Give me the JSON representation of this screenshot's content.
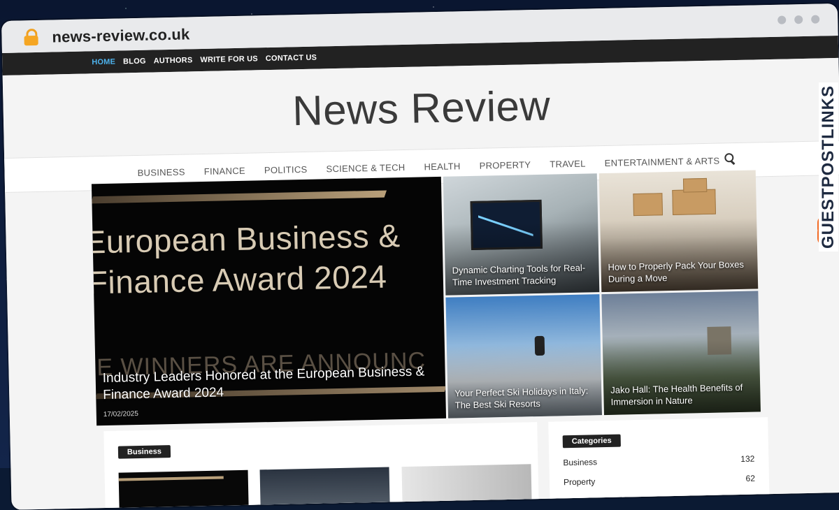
{
  "browser": {
    "url": "news-review.co.uk"
  },
  "top_nav": [
    "HOME",
    "BLOG",
    "AUTHORS",
    "WRITE FOR US",
    "CONTACT US"
  ],
  "site": {
    "title": "News Review"
  },
  "category_nav": [
    "BUSINESS",
    "FINANCE",
    "POLITICS",
    "SCIENCE & TECH",
    "HEALTH",
    "PROPERTY",
    "TRAVEL",
    "ENTERTAINMENT & ARTS"
  ],
  "hero": {
    "main": {
      "image_text_1": "European Business &",
      "image_text_2": "Finance Award 2024",
      "image_text_3": "E WINNERS ARE ANNOUNC",
      "title": "Industry Leaders Honored at the European Business & Finance Award 2024",
      "date": "17/02/2025"
    },
    "tiles": [
      {
        "title": "Dynamic Charting Tools for Real-Time Investment Tracking"
      },
      {
        "title": "How to Properly Pack Your Boxes During a Move"
      },
      {
        "title": "Your Perfect Ski Holidays in Italy: The Best Ski Resorts"
      },
      {
        "title": "Jako Hall: The Health Benefits of Immersion in Nature"
      }
    ]
  },
  "section": {
    "label": "Business"
  },
  "sidebar": {
    "heading": "Categories",
    "categories": [
      {
        "name": "Business",
        "count": "132"
      },
      {
        "name": "Property",
        "count": "62"
      }
    ]
  },
  "watermark": {
    "text": "GUESTPOSTLINKS"
  },
  "colors": {
    "accent": "#4db2ec",
    "watermark_logo": "#f26a24",
    "topbar": "#222222"
  }
}
